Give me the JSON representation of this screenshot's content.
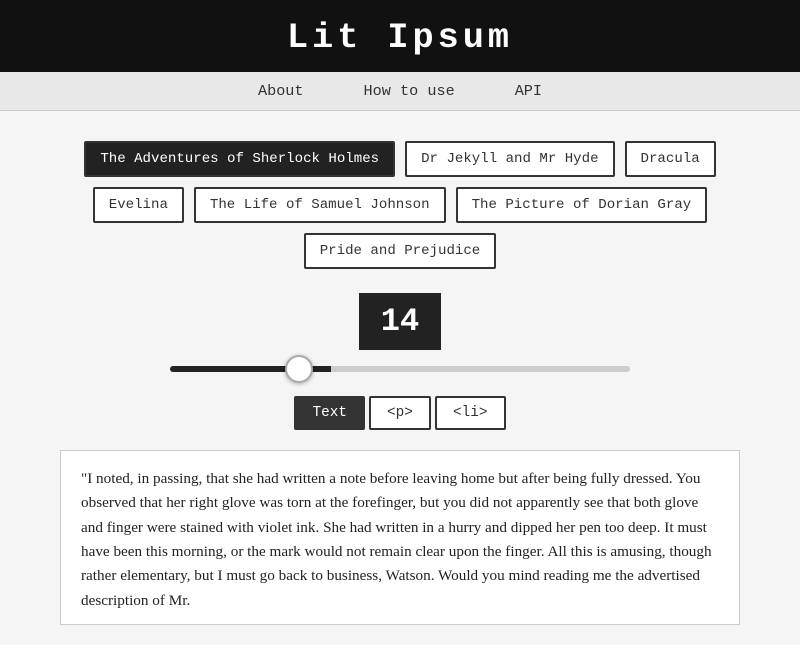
{
  "header": {
    "title": "Lit Ipsum"
  },
  "nav": {
    "items": [
      {
        "label": "About",
        "id": "about"
      },
      {
        "label": "How to use",
        "id": "how-to-use"
      },
      {
        "label": "API",
        "id": "api"
      }
    ]
  },
  "books": [
    {
      "label": "The Adventures of Sherlock Holmes",
      "id": "sherlock",
      "active": true
    },
    {
      "label": "Dr Jekyll and Mr Hyde",
      "id": "jekyll",
      "active": false
    },
    {
      "label": "Dracula",
      "id": "dracula",
      "active": false
    },
    {
      "label": "Evelina",
      "id": "evelina",
      "active": false
    },
    {
      "label": "The Life of Samuel Johnson",
      "id": "samuel",
      "active": false
    },
    {
      "label": "The Picture of Dorian Gray",
      "id": "dorian",
      "active": false
    },
    {
      "label": "Pride and Prejudice",
      "id": "pride",
      "active": false
    }
  ],
  "number": {
    "value": "14"
  },
  "slider": {
    "min": 1,
    "max": 50,
    "value": 14
  },
  "formats": [
    {
      "label": "Text",
      "id": "text",
      "active": true
    },
    {
      "label": "<p>",
      "id": "p",
      "active": false
    },
    {
      "label": "<li>",
      "id": "li",
      "active": false
    }
  ],
  "output": {
    "text": "\"I noted, in passing, that she had written a note before leaving home but after being fully dressed. You observed that her right glove was torn at the forefinger, but you did not apparently see that both glove and finger were stained with violet ink. She had written in a hurry and dipped her pen too deep. It must have been this morning, or the mark would not remain clear upon the finger. All this is amusing, though rather elementary, but I must go back to business, Watson. Would you mind reading me the advertised description of Mr."
  }
}
